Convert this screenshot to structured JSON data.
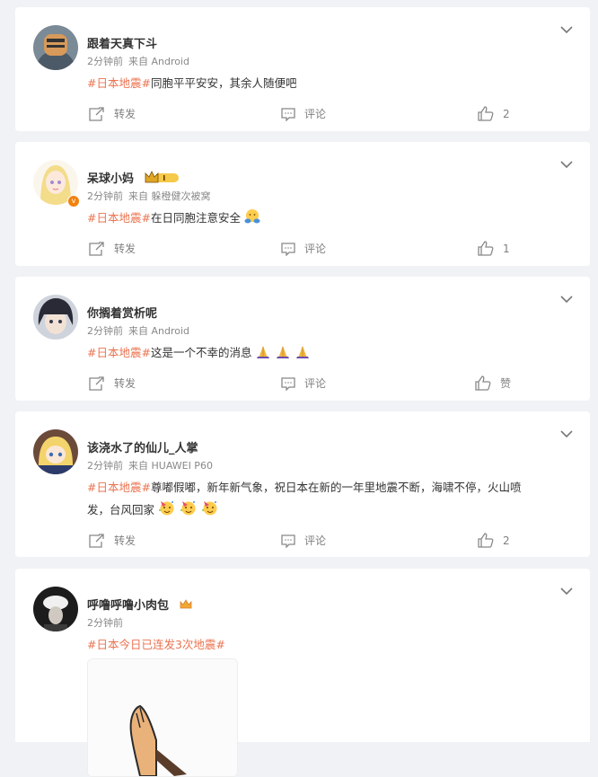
{
  "posts": [
    {
      "name": "跟着天真下斗",
      "time": "2分钟前",
      "source": "来自 Android",
      "hashtag": "#日本地震#",
      "text": "同胞平平安安，其余人随便吧",
      "repost_label": "转发",
      "comment_label": "评论",
      "like_count": "2"
    },
    {
      "name": "呆球小妈",
      "time": "2分钟前",
      "source": "来自 躲橙健次被窝",
      "hashtag": "#日本地震#",
      "text": "在日同胞注意安全",
      "repost_label": "转发",
      "comment_label": "评论",
      "like_count": "1",
      "verified_mark": "v"
    },
    {
      "name": "你搁着赏析呢",
      "time": "2分钟前",
      "source": "来自 Android",
      "hashtag": "#日本地震#",
      "text": "这是一个不幸的消息",
      "repost_label": "转发",
      "comment_label": "评论",
      "like_count": "赞"
    },
    {
      "name": "该浇水了的仙儿_人掌",
      "time": "2分钟前",
      "source": "来自 HUAWEI P60",
      "hashtag": "#日本地震#",
      "text_line1": "尊嘟假嘟，新年新气象，祝日本在新的一年里地震不断，海啸不停，火山喷",
      "text_line2": "发，台风回家",
      "repost_label": "转发",
      "comment_label": "评论",
      "like_count": "2"
    },
    {
      "name": "呼噜呼噜小肉包",
      "time": "2分钟前",
      "hashtag": "#日本今日已连发3次地震#"
    }
  ],
  "colors": {
    "hashtag": "#eb7350",
    "meta": "#888888",
    "background": "#f1f2f5"
  },
  "icons": [
    "chevron-down-icon",
    "repost-icon",
    "comment-icon",
    "like-icon",
    "crown-badge-icon",
    "praying-hands-emoji",
    "party-face-emoji",
    "hugging-face-emoji"
  ]
}
